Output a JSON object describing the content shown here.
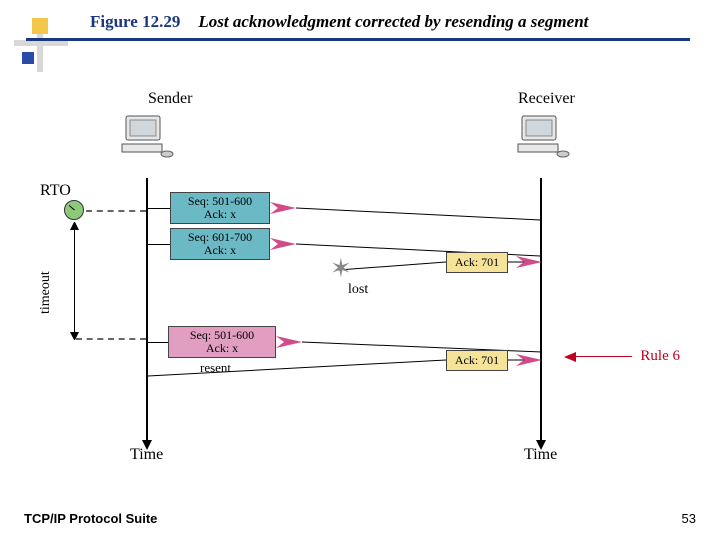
{
  "title": {
    "figure_no": "Figure 12.29",
    "caption": "Lost acknowledgment corrected by resending a segment"
  },
  "diagram": {
    "hosts": {
      "sender": "Sender",
      "receiver": "Receiver"
    },
    "rto": "RTO",
    "timeout": "timeout",
    "time": "Time",
    "lost": "lost",
    "resent": "resent",
    "rule6": "Rule 6",
    "segments": {
      "seg1": {
        "seq": "Seq: 501-600",
        "ack": "Ack: x"
      },
      "seg2": {
        "seq": "Seq: 601-700",
        "ack": "Ack: x"
      },
      "ack1": "Ack: 701",
      "seg3": {
        "seq": "Seq: 501-600",
        "ack": "Ack: x"
      },
      "ack2": "Ack: 701"
    }
  },
  "footer": {
    "suite": "TCP/IP Protocol Suite",
    "page": "53"
  }
}
